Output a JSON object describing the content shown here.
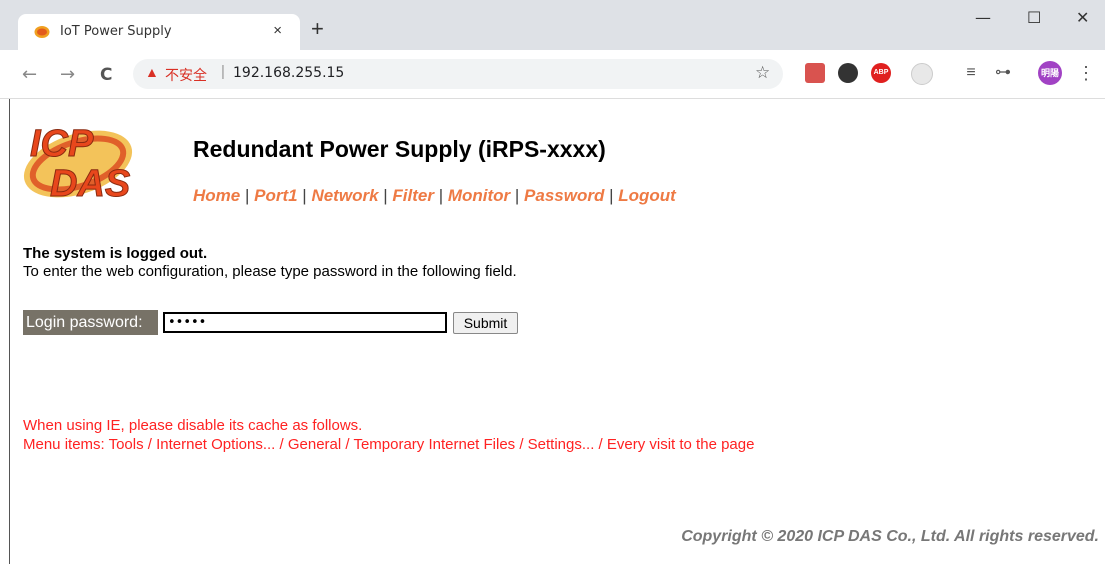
{
  "browser": {
    "tab_title": "IoT Power Supply",
    "tab_close": "×",
    "new_tab": "+",
    "window": {
      "minimize": "—",
      "maximize": "☐",
      "close": "✕"
    },
    "nav": {
      "back": "←",
      "forward": "→",
      "reload": "C"
    },
    "security_warning": "不安全",
    "separator": "|",
    "url": "192.168.255.15",
    "bookmark_star": "☆",
    "extensions": [
      "pdf-icon",
      "ghostery-icon",
      "adblock-plus-icon",
      "screenshot-icon",
      "reading-list-icon",
      "key-icon",
      "profile-avatar",
      "menu-icon"
    ],
    "abp_label": "ABP",
    "profile_label": "明陽",
    "menu_dots": "⋮",
    "reading_list": "≡",
    "key": "⊶"
  },
  "page": {
    "logo_text_line1": "ICP",
    "logo_text_line2": "DAS",
    "title": "Redundant Power Supply (iRPS-xxxx)",
    "menu": [
      "Home",
      "Port1",
      "Network",
      "Filter",
      "Monitor",
      "Password",
      "Logout"
    ],
    "menu_separator": " | ",
    "status": "The system is logged out.",
    "hint": "To enter the web configuration, please type password in the following field.",
    "login_label": "Login password:",
    "password_value": "•••••",
    "submit_label": "Submit",
    "ie_note_line1": "When using IE, please disable its cache as follows.",
    "ie_note_line2": "Menu items: Tools / Internet Options... / General / Temporary Internet Files / Settings... / Every visit to the page",
    "copyright": "Copyright © 2020 ICP DAS Co., Ltd. All rights reserved."
  },
  "colors": {
    "menu_link": "#ee7a44",
    "warning_red": "#ff2222",
    "label_bg": "#777267"
  }
}
